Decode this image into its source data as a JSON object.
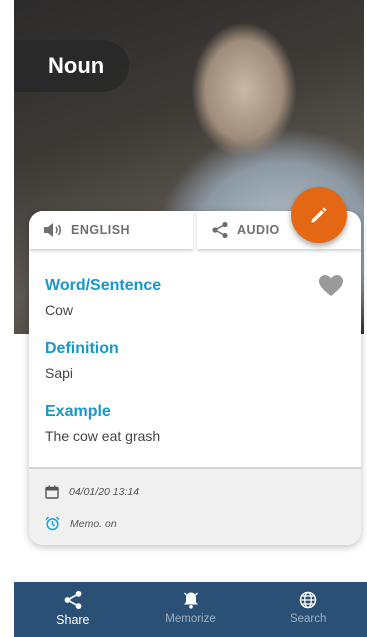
{
  "hero": {
    "part_of_speech": "Noun"
  },
  "card": {
    "toolbar": {
      "english_label": "ENGLISH",
      "audio_label": "AUDIO"
    },
    "fields": [
      {
        "label": "Word/Sentence",
        "value": "Cow"
      },
      {
        "label": "Definition",
        "value": "Sapi"
      },
      {
        "label": "Example",
        "value": "The cow eat grash"
      }
    ],
    "footer": {
      "date": "04/01/20 13:14",
      "memo": "Memo. on"
    }
  },
  "nav": {
    "items": [
      {
        "label": "Share",
        "icon": "share-icon",
        "active": true
      },
      {
        "label": "Memorize",
        "icon": "bell-icon",
        "active": false
      },
      {
        "label": "Search",
        "icon": "globe-icon",
        "active": false
      }
    ]
  },
  "colors": {
    "accent": "#1797cc",
    "fab": "#e46714",
    "nav_bg": "#2b5076",
    "alarm": "#1aa3d9"
  }
}
